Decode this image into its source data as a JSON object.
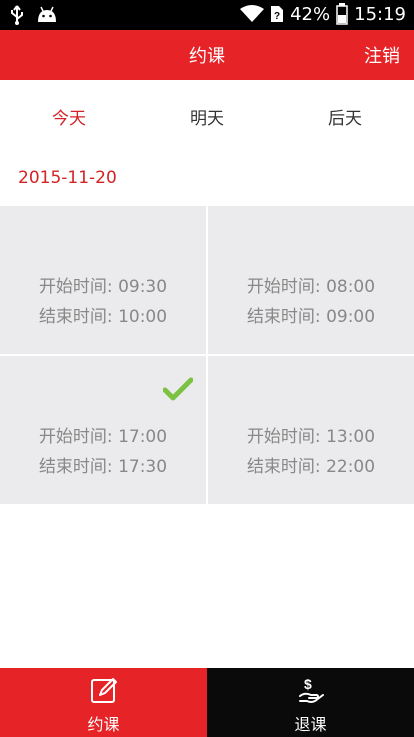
{
  "status_bar": {
    "battery": "42%",
    "time": "15:19",
    "icons": [
      "usb-icon",
      "android-icon",
      "wifi-icon",
      "sim-icon",
      "battery-icon"
    ]
  },
  "header": {
    "title": "约课",
    "logout": "注销"
  },
  "day_tabs": [
    {
      "label": "今天",
      "active": true
    },
    {
      "label": "明天",
      "active": false
    },
    {
      "label": "后天",
      "active": false
    }
  ],
  "date": "2015-11-20",
  "slots": [
    {
      "start": "开始时间: 09:30",
      "end": "结束时间: 10:00",
      "selected": false
    },
    {
      "start": "开始时间: 08:00",
      "end": "结束时间: 09:00",
      "selected": false
    },
    {
      "start": "开始时间: 17:00",
      "end": "结束时间: 17:30",
      "selected": true
    },
    {
      "start": "开始时间: 13:00",
      "end": "结束时间: 22:00",
      "selected": false
    }
  ],
  "bottom_nav": [
    {
      "label": "约课",
      "icon": "edit-icon",
      "active": true
    },
    {
      "label": "退课",
      "icon": "refund-icon",
      "active": false
    }
  ],
  "colors": {
    "brand": "#e62327",
    "accent_text": "#d22326",
    "grid_bg": "#ebebed",
    "check": "#7cc242"
  }
}
